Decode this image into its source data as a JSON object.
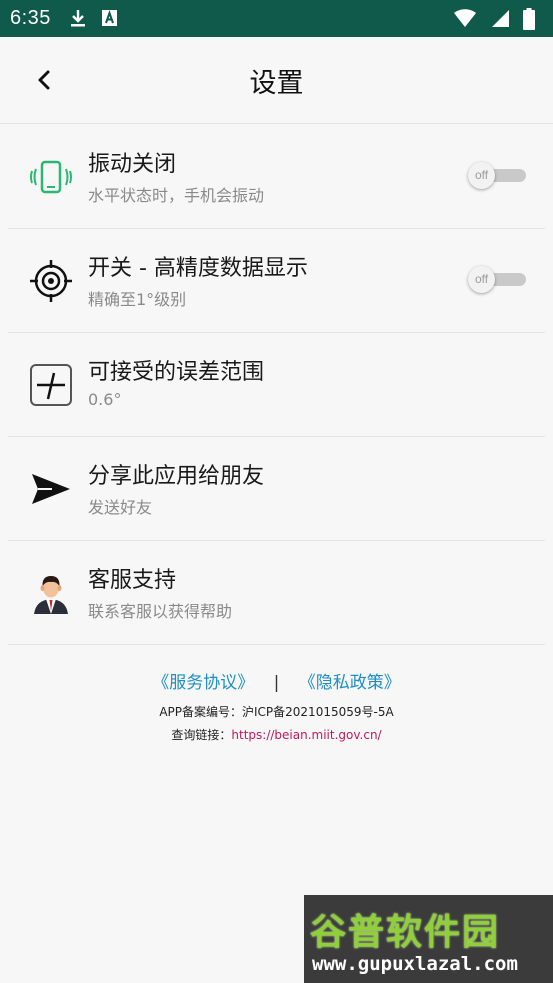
{
  "status_bar": {
    "time": "6:35",
    "left_icons": [
      "download-icon",
      "text-a-icon"
    ],
    "right_icons": [
      "wifi-icon",
      "cell-signal-icon",
      "battery-icon"
    ],
    "background": "#0f5a4b"
  },
  "header": {
    "title": "设置"
  },
  "items": [
    {
      "icon": "vibrate-phone-icon",
      "title": "振动关闭",
      "subtitle": "水平状态时，手机会振动",
      "toggle": {
        "label": "off",
        "on": false
      }
    },
    {
      "icon": "crosshair-icon",
      "title": "开关 - 高精度数据显示",
      "subtitle": "精确至1°级别",
      "toggle": {
        "label": "off",
        "on": false
      }
    },
    {
      "icon": "tolerance-icon",
      "title": "可接受的误差范围",
      "subtitle": "0.6°"
    },
    {
      "icon": "share-send-icon",
      "title": "分享此应用给朋友",
      "subtitle": "发送好友"
    },
    {
      "icon": "customer-service-icon",
      "title": "客服支持",
      "subtitle": "联系客服以获得帮助"
    }
  ],
  "footer": {
    "service_agreement": "《服务协议》",
    "separator": "|",
    "privacy_policy": "《隐私政策》",
    "beian": "APP备案编号：沪ICP备2021015059号-5A",
    "query_label": "查询链接：",
    "query_url": "https://beian.miit.gov.cn/"
  },
  "watermark": {
    "title": "谷普软件园",
    "url": "www.gupuxlazal.com"
  },
  "colors": {
    "link": "#1e8fc4",
    "url": "#c2185b",
    "accent_green": "#2bb673"
  }
}
